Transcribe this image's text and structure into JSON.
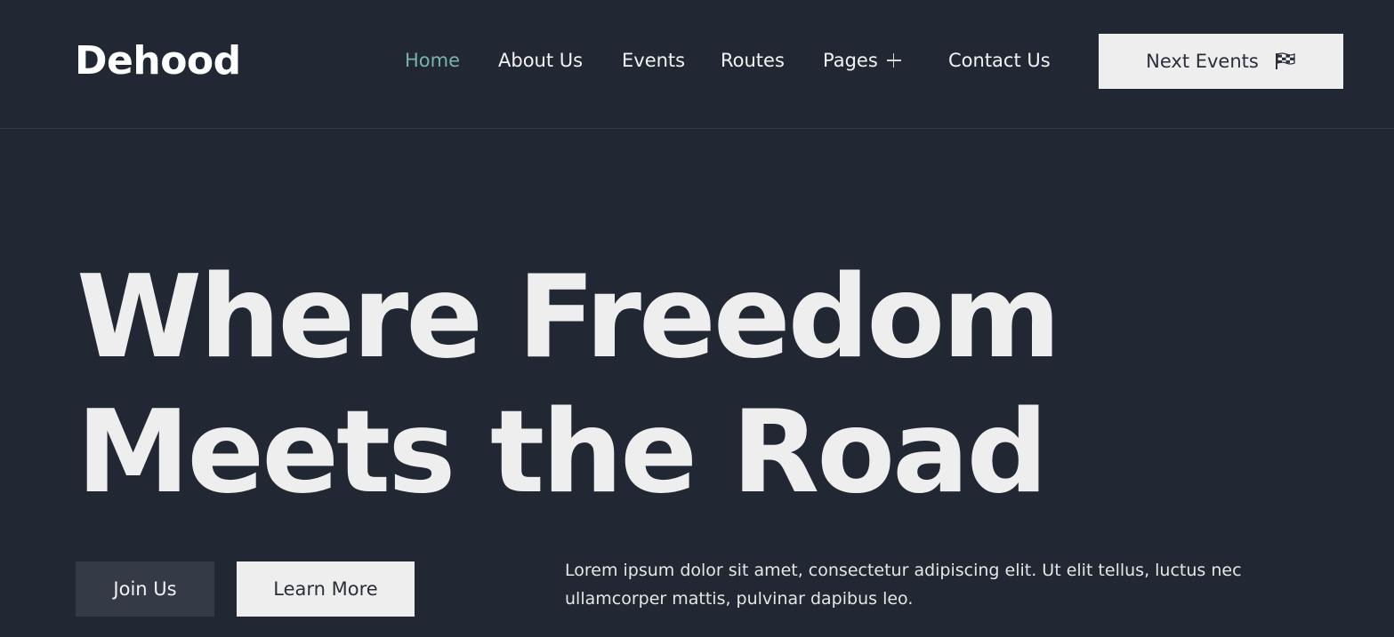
{
  "brand": {
    "logo_text": "Dehood"
  },
  "nav": {
    "items": [
      {
        "label": "Home",
        "active": true
      },
      {
        "label": "About Us"
      },
      {
        "label": "Events"
      },
      {
        "label": "Routes"
      },
      {
        "label": "Pages",
        "has_submenu": true
      },
      {
        "label": "Contact Us"
      }
    ],
    "cta_label": "Next Events",
    "cta_icon": "checkered-flag-icon"
  },
  "hero": {
    "title_line1": "Where Freedom",
    "title_line2": "Meets the Road",
    "primary_button": "Join Us",
    "secondary_button": "Learn More",
    "description": "Lorem ipsum dolor sit amet, consectetur adipiscing elit. Ut elit tellus, luctus nec ullamcorper mattis, pulvinar dapibus leo."
  },
  "colors": {
    "background": "#222833",
    "accent": "#79b2ad",
    "light": "#eeeeee",
    "dark_button": "#343a46"
  }
}
